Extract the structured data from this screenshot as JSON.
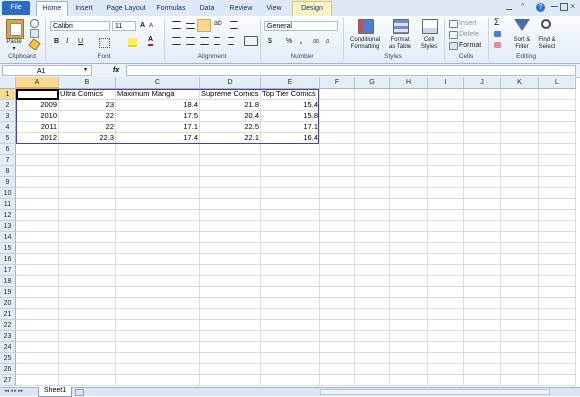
{
  "tabs": {
    "file": "File",
    "home": "Home",
    "insert": "Insert",
    "page_layout": "Page Layout",
    "formulas": "Formulas",
    "data": "Data",
    "review": "Review",
    "view": "View",
    "design": "Design"
  },
  "ribbon": {
    "clipboard": {
      "paste": "Paste",
      "label": "Clipboard"
    },
    "font": {
      "family": "Calibri",
      "size": "11",
      "label": "Font",
      "bold": "B",
      "italic": "I",
      "underline": "U"
    },
    "alignment": {
      "label": "Alignment"
    },
    "number": {
      "format": "General",
      "currency": "$",
      "percent": "%",
      "comma": ",",
      "label": "Number"
    },
    "styles": {
      "conditional": "Conditional",
      "conditional2": "Formatting",
      "format_as": "Format",
      "format_as2": "as Table",
      "cell_styles": "Cell",
      "cell_styles2": "Styles",
      "label": "Styles"
    },
    "cells": {
      "insert": "Insert",
      "delete": "Delete",
      "format": "Format",
      "label": "Cells"
    },
    "editing": {
      "sort": "Sort &",
      "sort2": "Filter",
      "find": "Find &",
      "find2": "Select",
      "label": "Editing",
      "sigma": "Σ"
    }
  },
  "formula_bar": {
    "name_box": "A1",
    "fx": "fx",
    "value": ""
  },
  "columns": [
    "A",
    "B",
    "C",
    "D",
    "E",
    "F",
    "G",
    "H",
    "I",
    "J",
    "K",
    "L"
  ],
  "rows": [
    "1",
    "2",
    "3",
    "4",
    "5",
    "6",
    "7",
    "8",
    "9",
    "10",
    "11",
    "12",
    "13",
    "14",
    "15",
    "16",
    "17",
    "18",
    "19",
    "20",
    "21",
    "22",
    "23",
    "24",
    "25",
    "26",
    "27"
  ],
  "table": {
    "headers": [
      "",
      "Ultra Comics",
      "Maximum Manga",
      "Supreme Comics",
      "Top Tier Comics"
    ],
    "data": [
      [
        "2009",
        "23",
        "18.4",
        "21.8",
        "15.4"
      ],
      [
        "2010",
        "22",
        "17.5",
        "20.4",
        "15.8"
      ],
      [
        "2011",
        "22",
        "17.1",
        "22.5",
        "17.1"
      ],
      [
        "2012",
        "22.3",
        "17.4",
        "22.1",
        "16.4"
      ]
    ]
  },
  "sheets": {
    "sheet1": "Sheet1"
  },
  "colors": {
    "file_tab": "#2b6bc2",
    "selected_header": "#f9d98f",
    "table_border": "#3b4aa0"
  }
}
